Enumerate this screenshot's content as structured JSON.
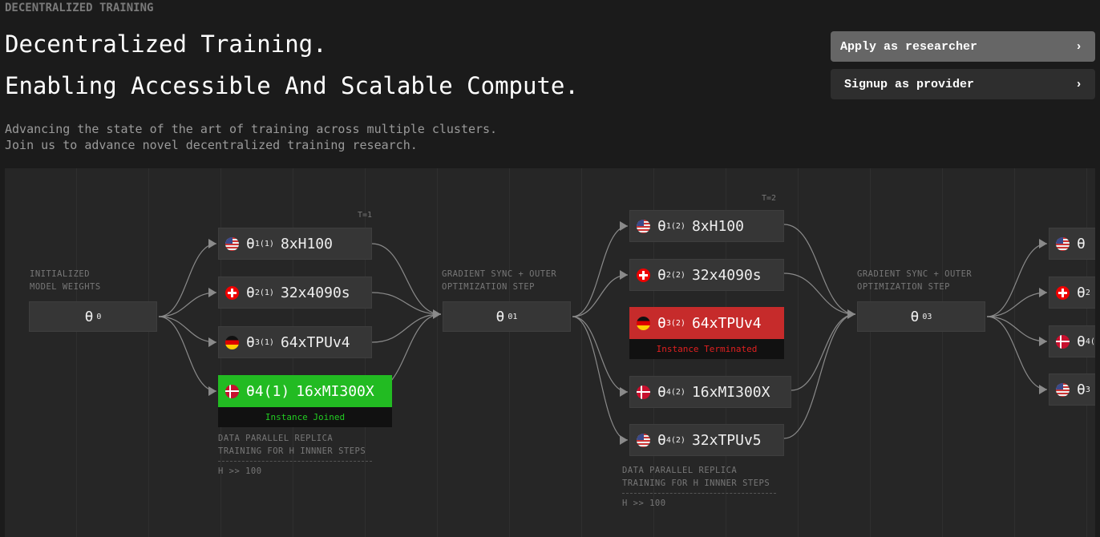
{
  "header": {
    "eyebrow": "DECENTRALIZED TRAINING",
    "title_line1": "Decentralized Training.",
    "title_line2": "Enabling Accessible And Scalable Compute.",
    "subtitle_line1": "Advancing the state of the art of training across multiple clusters.",
    "subtitle_line2": "Join us to advance novel decentralized training research."
  },
  "actions": [
    {
      "label": "Apply as researcher",
      "icon": "chevron-right-icon",
      "glyph": "›"
    },
    {
      "label": "Signup as provider",
      "icon": "chevron-right-icon",
      "glyph": "›"
    }
  ],
  "diagram": {
    "init": {
      "label1": "INITIALIZED",
      "label2": "MODEL WEIGHTS",
      "theta": "θ",
      "sup": "0"
    },
    "sync1": {
      "label1": "GRADIENT SYNC + OUTER",
      "label2": "OPTIMIZATION STEP",
      "theta": "θ",
      "sup": "01"
    },
    "sync2": {
      "label1": "GRADIENT SYNC + OUTER",
      "label2": "OPTIMIZATION STEP",
      "theta": "θ",
      "sup": "03"
    },
    "step1": {
      "t": "T=1",
      "replicas": [
        {
          "flag": "us",
          "sub": "1",
          "sup": "(1)",
          "hw": "8xH100"
        },
        {
          "flag": "ch",
          "sub": "2",
          "sup": "(1)",
          "hw": "32x4090s"
        },
        {
          "flag": "de",
          "sub": "3",
          "sup": "(1)",
          "hw": "64xTPUv4"
        },
        {
          "flag": "dk",
          "text": "θ4(1)",
          "hw": "16xMI300X",
          "status": "Instance Joined",
          "status_color": "#22cc22"
        }
      ],
      "note1": "DATA PARALLEL REPLICA",
      "note2": "TRAINING FOR H INNNER STEPS",
      "h": "H >> 100"
    },
    "step2": {
      "t": "T=2",
      "replicas": [
        {
          "flag": "us",
          "sub": "1",
          "sup": "(2)",
          "hw": "8xH100"
        },
        {
          "flag": "ch",
          "sub": "2",
          "sup": "(2)",
          "hw": "32x4090s"
        },
        {
          "flag": "de",
          "sub": "3",
          "sup": "(2)",
          "hw": "64xTPUv4",
          "status": "Instance Terminated",
          "status_color": "#e02020"
        },
        {
          "flag": "dk",
          "sub": "4",
          "sup": "(2)",
          "hw": "16xMI300X"
        },
        {
          "flag": "us",
          "sub": "4",
          "sup": "(2)",
          "hw": "32xTPUv5"
        }
      ],
      "note1": "DATA PARALLEL REPLICA",
      "note2": "TRAINING FOR H INNNER STEPS",
      "h": "H >> 100"
    },
    "step3": {
      "replicas": [
        {
          "flag": "us",
          "sub": "",
          "sup": "",
          "hw": ""
        },
        {
          "flag": "ch",
          "sub": "2",
          "sup": "",
          "hw": ""
        },
        {
          "flag": "dk",
          "sub": "4",
          "sup": "(",
          "hw": ""
        },
        {
          "flag": "us",
          "sub": "3",
          "sup": "",
          "hw": ""
        }
      ]
    },
    "colors": {
      "joined": "#22bb22",
      "terminated": "#c62b2b",
      "wire": "#8a8a8a"
    }
  }
}
